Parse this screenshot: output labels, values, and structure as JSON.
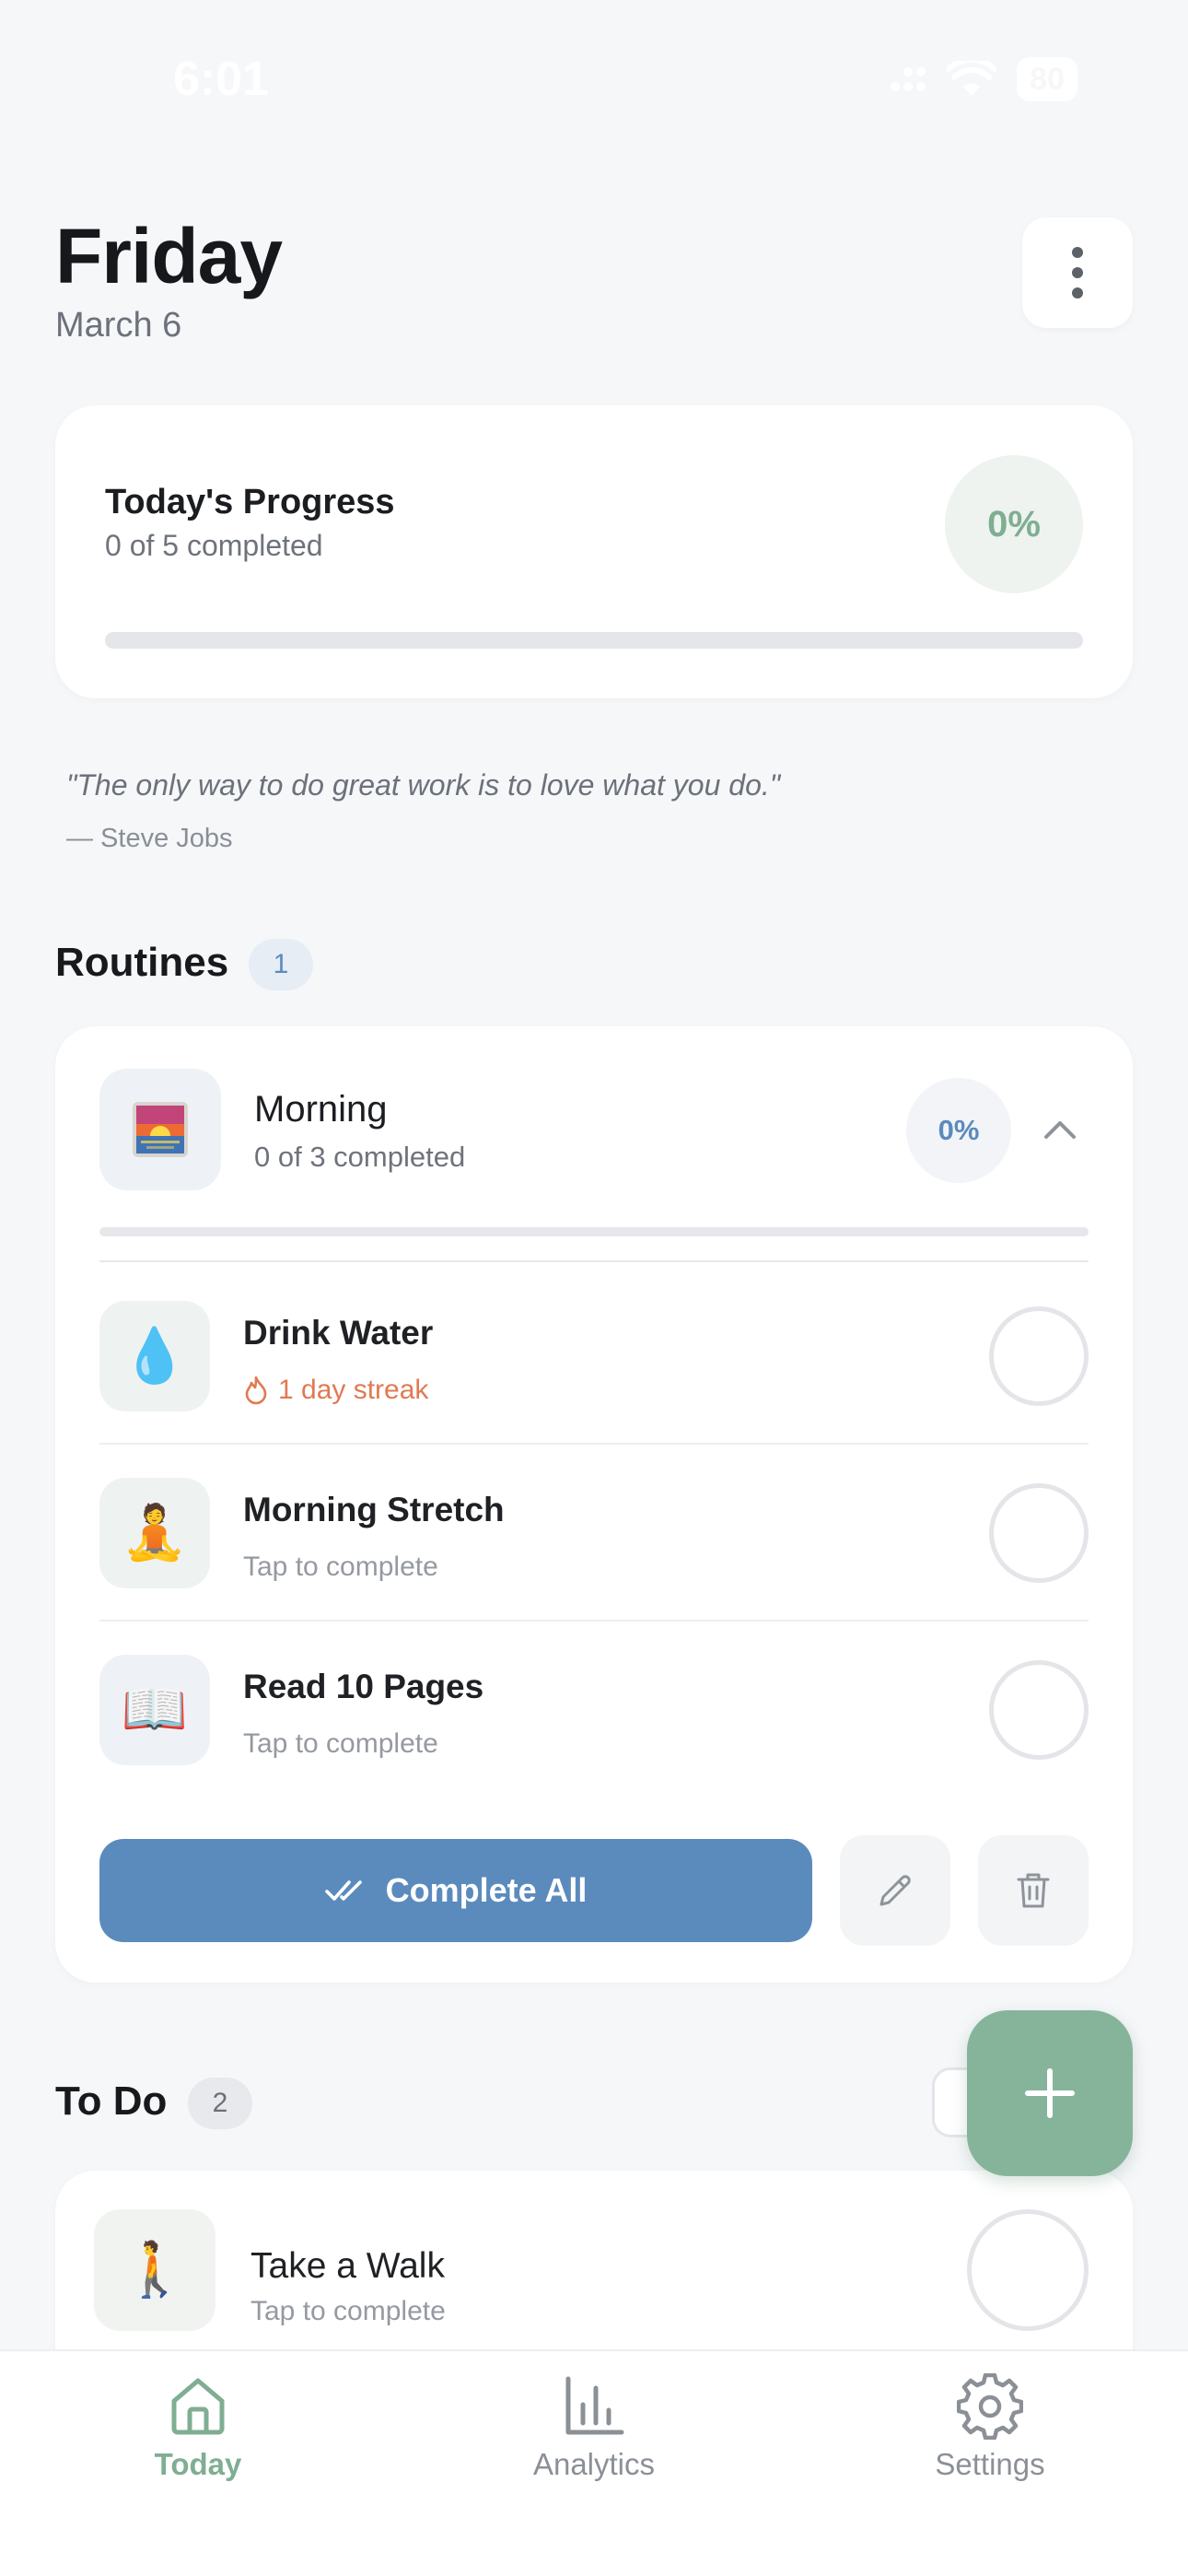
{
  "status": {
    "time": "6:01",
    "battery": "80"
  },
  "header": {
    "day": "Friday",
    "date": "March 6"
  },
  "progress": {
    "title": "Today's Progress",
    "subtitle": "0 of 5 completed",
    "percent_label": "0%",
    "fraction": 0
  },
  "quote": {
    "text": "\"The only way to do great work is to love what you do.\"",
    "author": "— Steve Jobs"
  },
  "routines": {
    "title": "Routines",
    "count": "1",
    "routine": {
      "emoji": "🌅",
      "name": "Morning",
      "subtitle": "0 of 3 completed",
      "percent_label": "0%",
      "fraction": 0,
      "habits": [
        {
          "emoji": "💧",
          "name": "Drink Water",
          "subtitle": "1 day streak",
          "icon_bg": "#eef3f1"
        },
        {
          "emoji": "🧘",
          "name": "Morning Stretch",
          "subtitle": "Tap to complete",
          "icon_bg": "#eef3f1"
        },
        {
          "emoji": "📖",
          "name": "Read 10 Pages",
          "subtitle": "Tap to complete",
          "icon_bg": "#eef2f6"
        }
      ],
      "complete_all_label": "Complete All"
    }
  },
  "todo": {
    "title": "To Do",
    "count": "2",
    "items": [
      {
        "emoji": "🚶",
        "name": "Take a Walk",
        "subtitle": "Tap to complete"
      }
    ]
  },
  "tabs": [
    {
      "label": "Today",
      "icon": "home-icon",
      "active": true
    },
    {
      "label": "Analytics",
      "icon": "bar-chart-icon",
      "active": false
    },
    {
      "label": "Settings",
      "icon": "gear-icon",
      "active": false
    }
  ],
  "colors": {
    "accent_green": "#7fae92",
    "accent_blue": "#5b8bbd",
    "streak_orange": "#e07a52",
    "fab_green": "#86b49a"
  }
}
